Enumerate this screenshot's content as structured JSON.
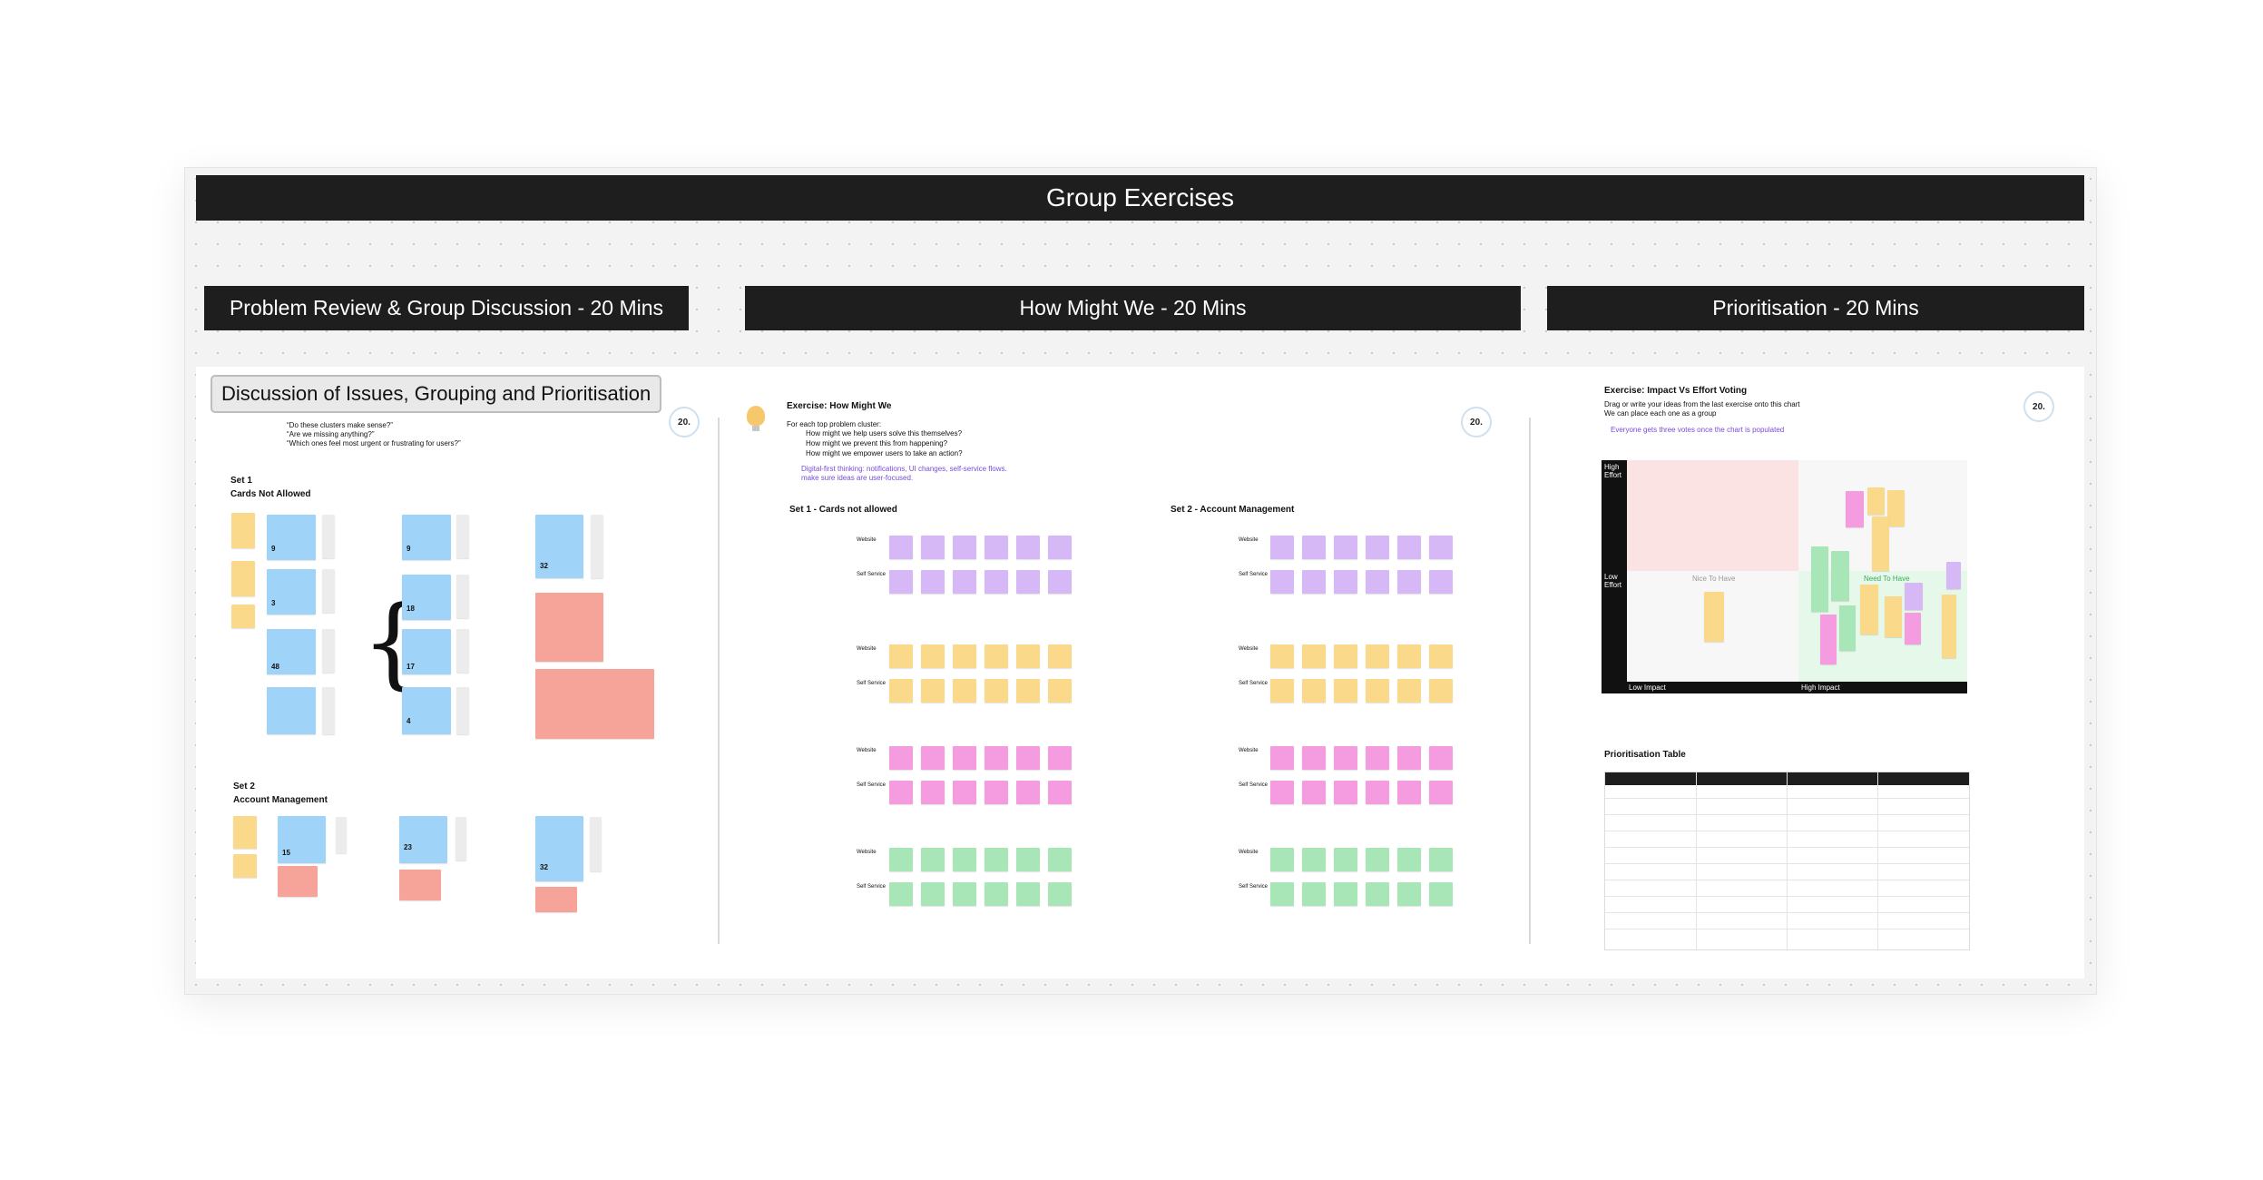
{
  "main_title": "Group Exercises",
  "sections": {
    "problem_review": "Problem Review & Group Discussion - 20 Mins",
    "how_might_we": "How Might We - 20 Mins",
    "prioritisation": "Prioritisation - 20 Mins"
  },
  "discussion": {
    "title": "Discussion of Issues, Grouping and Prioritisation",
    "timer": "20.",
    "questions": [
      "“Do these clusters make sense?”",
      "“Are we missing anything?”",
      "“Which ones feel most urgent or frustrating for users?”"
    ],
    "set1_label": "Set 1",
    "set1_title": "Cards Not Allowed",
    "set2_label": "Set 2",
    "set2_title": "Account Management",
    "counts": [
      "9",
      "3",
      "48",
      "9",
      "18",
      "17",
      "4",
      "32",
      "15",
      "23",
      "32"
    ]
  },
  "hmw": {
    "title": "Exercise: How Might We",
    "timer": "20.",
    "intro": "For each top problem cluster:",
    "bullets": [
      "How might we help users solve this themselves?",
      "How might we prevent this from happening?",
      "How might we empower users to take an action?"
    ],
    "note_line1": "Digital-first thinking: notifications, UI changes, self-service flows.",
    "note_line2": "make sure ideas are user-focused.",
    "set1": "Set 1 - Cards not allowed",
    "set2": "Set 2 - Account Management",
    "row_website": "Website",
    "row_self_service": "Self Service"
  },
  "prio": {
    "title": "Exercise: Impact Vs Effort Voting",
    "timer": "20.",
    "line1": "Drag or write your ideas from the last exercise onto this chart",
    "line2": "We can place each one as a group",
    "line3": "Everyone gets three votes once the chart is populated",
    "high_effort": "High Effort",
    "low_effort": "Low Effort",
    "low_impact": "Low Impact",
    "high_impact": "High Impact",
    "q_nice": "Nice To Have",
    "q_need": "Need To Have",
    "table_title": "Prioritisation Table"
  },
  "colors": {
    "banner": "#1e1e1e",
    "yellow_note": "#fbd98a",
    "blue_note": "#9fd3f7",
    "red_note": "#f6a49a",
    "lavender_note": "#d5b8f5",
    "pink_note": "#f59be0",
    "green_note": "#a8e6b8",
    "link_purple": "#7a4ad6"
  }
}
